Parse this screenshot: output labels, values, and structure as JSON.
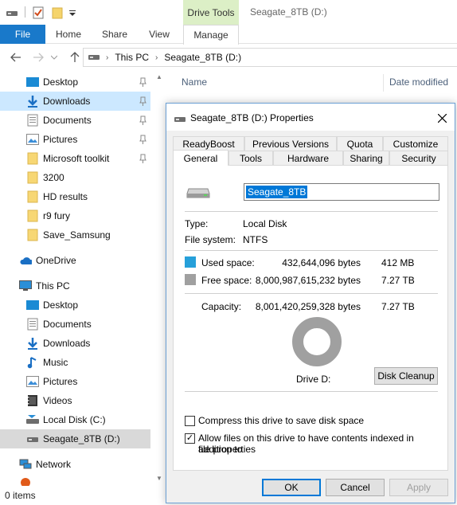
{
  "window": {
    "title": "Seagate_8TB (D:)",
    "contextual_group": "Drive Tools"
  },
  "ribbon": {
    "tabs": [
      "File",
      "Home",
      "Share",
      "View",
      "Manage"
    ]
  },
  "address": {
    "crumbs": [
      "This PC",
      "Seagate_8TB (D:)"
    ]
  },
  "nav": {
    "quick_access": [
      {
        "label": "Desktop",
        "icon": "desktop-folder-icon",
        "pinned": true
      },
      {
        "label": "Downloads",
        "icon": "downloads-arrow-icon",
        "pinned": true,
        "selected": true
      },
      {
        "label": "Documents",
        "icon": "documents-icon",
        "pinned": true
      },
      {
        "label": "Pictures",
        "icon": "pictures-icon",
        "pinned": true
      },
      {
        "label": "Microsoft toolkit",
        "icon": "folder-icon",
        "pinned": true
      },
      {
        "label": "3200",
        "icon": "folder-icon"
      },
      {
        "label": "HD results",
        "icon": "folder-icon"
      },
      {
        "label": "r9 fury",
        "icon": "folder-icon"
      },
      {
        "label": "Save_Samsung",
        "icon": "folder-icon"
      }
    ],
    "onedrive": "OneDrive",
    "this_pc": "This PC",
    "this_pc_items": [
      {
        "label": "Desktop",
        "icon": "desktop-folder-icon"
      },
      {
        "label": "Documents",
        "icon": "documents-icon"
      },
      {
        "label": "Downloads",
        "icon": "downloads-arrow-icon"
      },
      {
        "label": "Music",
        "icon": "music-note-icon"
      },
      {
        "label": "Pictures",
        "icon": "pictures-icon"
      },
      {
        "label": "Videos",
        "icon": "videos-icon"
      },
      {
        "label": "Local Disk (C:)",
        "icon": "local-disk-icon"
      },
      {
        "label": "Seagate_8TB (D:)",
        "icon": "drive-icon",
        "selected": true
      }
    ],
    "network": "Network"
  },
  "content": {
    "col_name": "Name",
    "col_date": "Date modified"
  },
  "status": {
    "items_text": "0 items"
  },
  "dialog": {
    "title": "Seagate_8TB (D:) Properties",
    "tabs_row1": [
      "ReadyBoost",
      "Previous Versions",
      "Quota",
      "Customize"
    ],
    "tabs_row2": [
      "General",
      "Tools",
      "Hardware",
      "Sharing",
      "Security"
    ],
    "active_tab": "General",
    "name_value": "Seagate_8TB",
    "type_label": "Type:",
    "type_value": "Local Disk",
    "fs_label": "File system:",
    "fs_value": "NTFS",
    "used_label": "Used space:",
    "used_bytes": "432,644,096 bytes",
    "used_size": "412 MB",
    "free_label": "Free space:",
    "free_bytes": "8,000,987,615,232 bytes",
    "free_size": "7.27 TB",
    "capacity_label": "Capacity:",
    "capacity_bytes": "8,001,420,259,328 bytes",
    "capacity_size": "7.27 TB",
    "drive_label": "Drive D:",
    "disk_cleanup": "Disk Cleanup",
    "compress_label": "Compress this drive to save disk space",
    "compress_checked": false,
    "index_label_line1": "Allow files on this drive to have contents indexed in addition to",
    "index_label_line2": "file properties",
    "index_checked": true,
    "ok": "OK",
    "cancel": "Cancel",
    "apply": "Apply",
    "colors": {
      "used": "#26a0da",
      "free": "#a0a0a0",
      "accent": "#0078d7"
    },
    "used_fraction": 5e-05
  }
}
